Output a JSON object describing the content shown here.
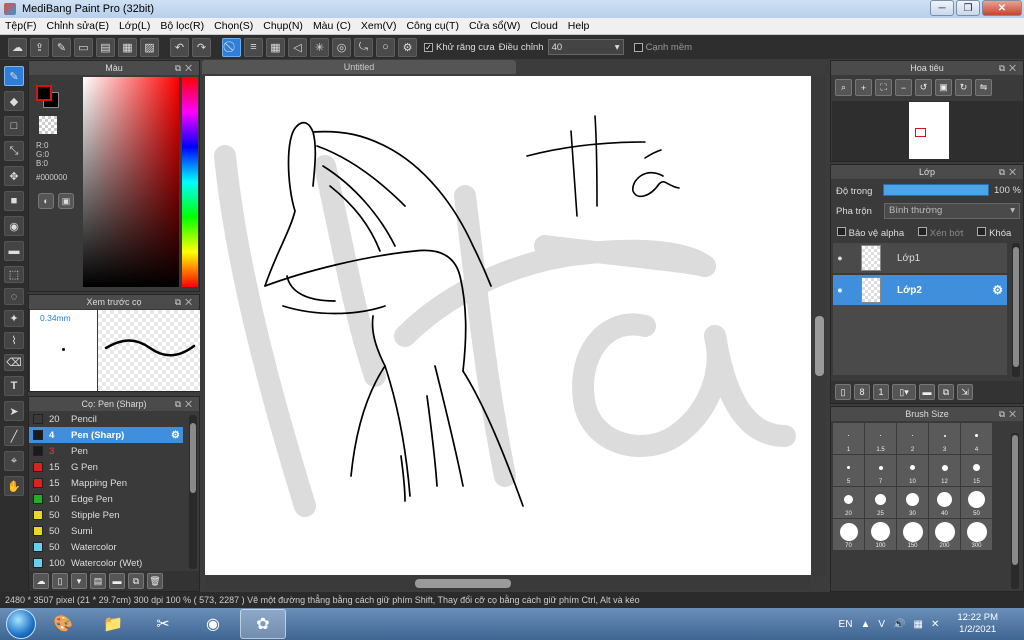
{
  "window": {
    "title": "MediBang Paint Pro (32bit)",
    "minimize": "─",
    "maximize": "❐",
    "close": "✕"
  },
  "menu": [
    "Tệp(F)",
    "Chỉnh sửa(E)",
    "Lớp(L)",
    "Bộ lọc(R)",
    "Chọn(S)",
    "Chụp(N)",
    "Màu (C)",
    "Xem(V)",
    "Công cụ(T)",
    "Cửa sổ(W)",
    "Cloud",
    "Help"
  ],
  "toolbar": {
    "antialias_label": "Khử răng cưa",
    "correction_label": "Điều chỉnh",
    "correction_value": "40",
    "soft_edge_label": "Cạnh mềm"
  },
  "color_panel": {
    "title": "Màu",
    "r": "R:0",
    "g": "G:0",
    "b": "B:0",
    "hex": "#000000"
  },
  "brush_preview": {
    "title": "Xem trước cọ",
    "size": "0.34mm"
  },
  "brush_list": {
    "title": "Cọ: Pen (Sharp)",
    "items": [
      {
        "size": "20",
        "name": "Pencil",
        "color": "#3a3a3a"
      },
      {
        "size": "4",
        "name": "Pen (Sharp)",
        "color": "#1a1a1a"
      },
      {
        "size": "3",
        "name": "Pen",
        "color": "#1a1a1a"
      },
      {
        "size": "15",
        "name": "G Pen",
        "color": "#e02020"
      },
      {
        "size": "15",
        "name": "Mapping Pen",
        "color": "#e02020"
      },
      {
        "size": "10",
        "name": "Edge Pen",
        "color": "#20b020"
      },
      {
        "size": "50",
        "name": "Stipple Pen",
        "color": "#e8d820"
      },
      {
        "size": "50",
        "name": "Sumi",
        "color": "#e8d820"
      },
      {
        "size": "50",
        "name": "Watercolor",
        "color": "#6ad0f0"
      },
      {
        "size": "100",
        "name": "Watercolor (Wet)",
        "color": "#6ad0f0"
      }
    ]
  },
  "canvas": {
    "tab_title": "Untitled",
    "handwriting": "Hà"
  },
  "navigator": {
    "title": "Hoa tiêu"
  },
  "layers": {
    "title": "Lớp",
    "opacity_label": "Độ trong",
    "opacity_value": "100 %",
    "opacity_fraction": 1.0,
    "blend_label": "Pha trộn",
    "blend_value": "Bình thường",
    "protect_alpha": "Bảo vệ alpha",
    "clipping": "Xén bớt",
    "lock": "Khóa",
    "items": [
      {
        "name": "Lớp1",
        "selected": false
      },
      {
        "name": "Lớp2",
        "selected": true
      }
    ]
  },
  "brush_size": {
    "title": "Brush Size",
    "sizes": [
      "1",
      "1.5",
      "2",
      "3",
      "4",
      "5",
      "7",
      "10",
      "12",
      "15",
      "20",
      "25",
      "30",
      "40",
      "50",
      "70",
      "100",
      "150",
      "200",
      "300"
    ]
  },
  "status": {
    "text": "2480 * 3507 pixel   (21 * 29.7cm)   300 dpi   100 %   ( 573, 2287 )   Vẽ một đường thẳng bằng cách giữ phím Shift, Thay đổi cỡ cọ bằng cách giữ phím Ctrl, Alt và kéo"
  },
  "taskbar": {
    "language": "EN",
    "time": "12:22 PM",
    "date": "1/2/2021"
  }
}
